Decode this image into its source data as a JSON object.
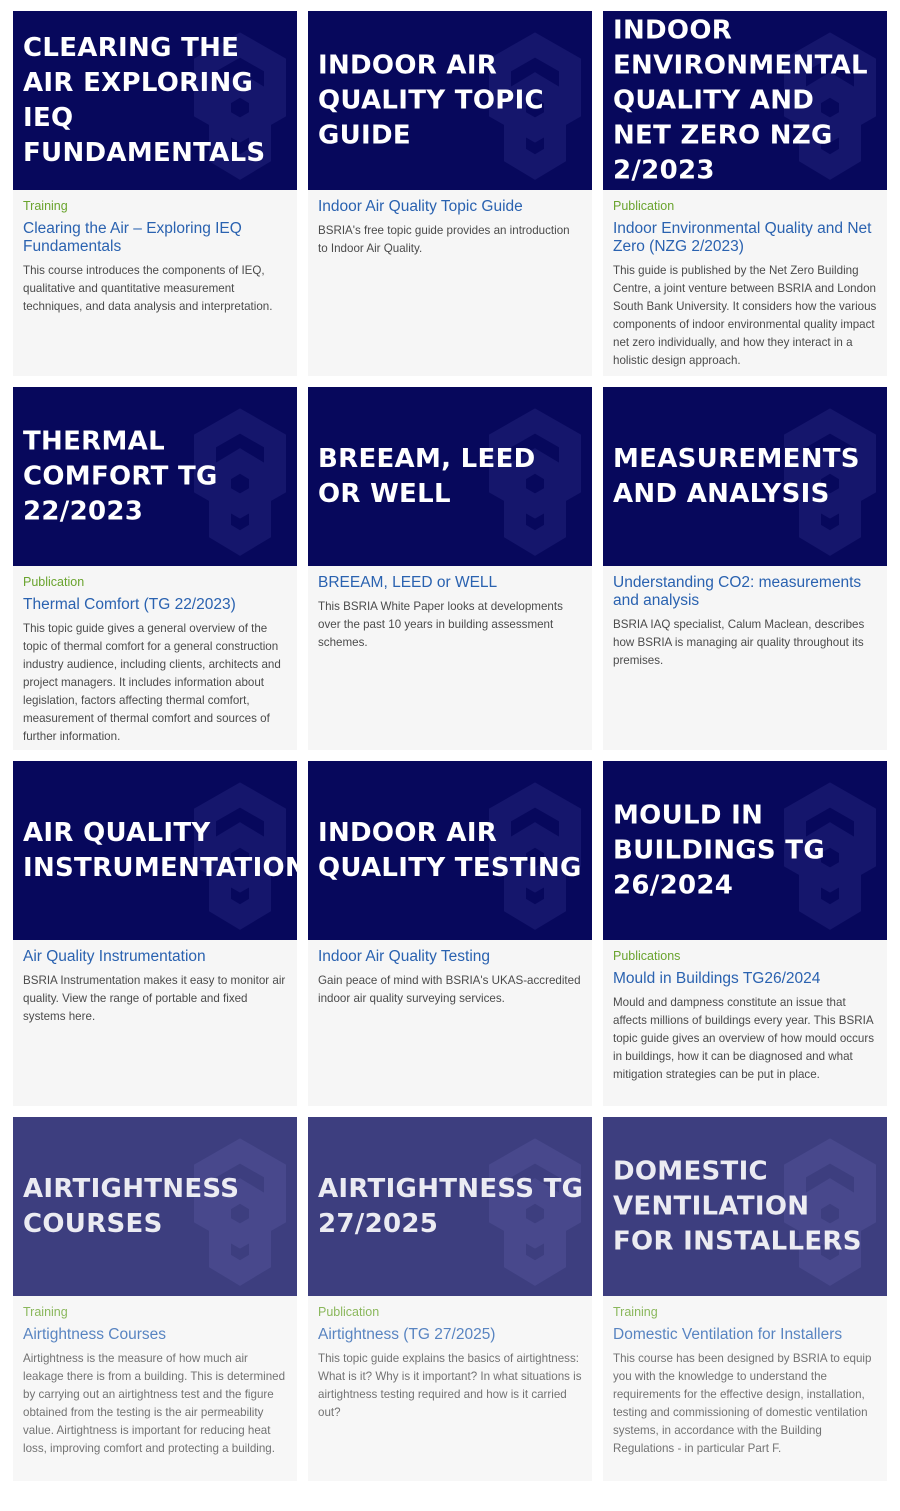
{
  "colors": {
    "banner": "#07085c",
    "category": "#6aa42e",
    "title": "#2a62b0",
    "text": "#4b4b4b",
    "card": "#f6f6f6"
  },
  "cards": [
    {
      "banner": "CLEARING THE AIR EXPLORING IEQ FUNDAMENTALS",
      "category": "Training",
      "title": "Clearing the Air – Exploring IEQ Fundamentals",
      "description": "This course introduces the components of IEQ, qualitative and quantitative measurement techniques, and data analysis and interpretation."
    },
    {
      "banner": "INDOOR AIR QUALITY TOPIC GUIDE",
      "category": "",
      "title": "Indoor Air Quality Topic Guide",
      "description": "BSRIA's free topic guide provides an introduction to Indoor Air Quality."
    },
    {
      "banner": "INDOOR ENVIRONMENTAL QUALITY AND NET ZERO NZG 2/2023",
      "category": "Publication",
      "title": "Indoor Environmental Quality and Net Zero (NZG 2/2023)",
      "description": "This guide is published by the Net Zero Building Centre, a joint venture between BSRIA and London South Bank University. It considers how the various components of indoor environmental quality impact net zero individually, and how they interact in a holistic design approach."
    },
    {
      "banner": "THERMAL COMFORT TG 22/2023",
      "category": "Publication",
      "title": "Thermal Comfort (TG 22/2023)",
      "description": "This topic guide gives a general overview of the topic of thermal comfort for a general construction industry audience, including clients, architects and project managers. It includes information about legislation, factors affecting thermal comfort, measurement of thermal comfort and sources of further information."
    },
    {
      "banner": "BREEAM, LEED OR WELL",
      "category": "",
      "title": "BREEAM, LEED or WELL",
      "description": "This BSRIA White Paper looks at developments over the past 10 years in building assessment schemes."
    },
    {
      "banner": "MEASUREMENTS AND ANALYSIS",
      "category": "",
      "title": "Understanding CO2: measurements and analysis",
      "description": "BSRIA IAQ specialist, Calum Maclean, describes how BSRIA is managing air quality throughout its premises."
    },
    {
      "banner": "AIR QUALITY INSTRUMENTATION",
      "category": "",
      "title": "Air Quality Instrumentation",
      "description": "BSRIA Instrumentation makes it easy to monitor air quality. View the range of portable and fixed systems here."
    },
    {
      "banner": "INDOOR AIR QUALITY TESTING",
      "category": "",
      "title": "Indoor Air Quality Testing",
      "description": "Gain peace of mind with BSRIA's UKAS-accredited indoor air quality surveying services."
    },
    {
      "banner": "MOULD IN BUILDINGS TG 26/2024",
      "category": "Publications",
      "title": "Mould in Buildings TG26/2024",
      "description": "Mould and dampness constitute an issue that affects millions of buildings every year. This BSRIA topic guide gives an overview of how mould occurs in buildings, how it can be diagnosed and what mitigation strategies can be put in place."
    },
    {
      "banner": "AIRTIGHTNESS COURSES",
      "category": "Training",
      "title": "Airtightness Courses",
      "description": "Airtightness is the measure of how much air leakage there is from a building. This is determined by carrying out an airtightness test and the figure obtained from the testing is the air permeability value. Airtightness is important for reducing heat loss, improving comfort and protecting a building."
    },
    {
      "banner": "AIRTIGHTNESS TG 27/2025",
      "category": "Publication",
      "title": "Airtightness (TG 27/2025)",
      "description": "This topic guide explains the basics of airtightness: What is it? Why is it important? In what situations is airtightness testing required and how is it carried out?"
    },
    {
      "banner": "DOMESTIC VENTILATION FOR INSTALLERS",
      "category": "Training",
      "title": "Domestic Ventilation for Installers",
      "description": "This course has been designed by BSRIA to equip you with the knowledge to understand the requirements for the effective design, installation, testing and commissioning of domestic ventilation systems, in accordance with the Building Regulations - in particular Part F."
    }
  ]
}
